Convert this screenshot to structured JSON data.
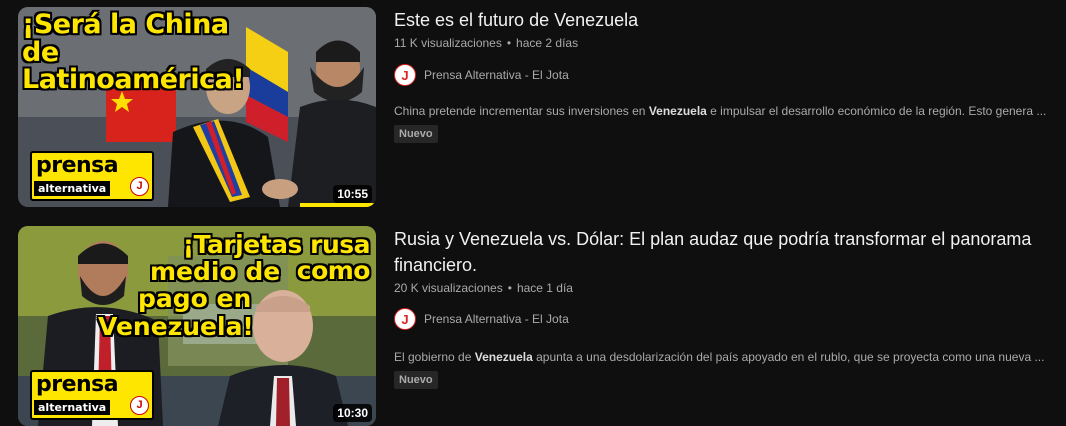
{
  "videos": [
    {
      "thumbnail_text": "¡Será la China de Latinoamérica!",
      "brand_main": "prensa",
      "brand_sub": "alternativa",
      "brand_logo": "J",
      "duration": "10:55",
      "title": "Este es el futuro de Venezuela",
      "views": "11 K visualizaciones",
      "age": "hace 2 días",
      "separator": "•",
      "channel": "Prensa Alternativa - El Jota",
      "avatar_letter": "J",
      "description_pre": "China pretende incrementar sus inversiones en ",
      "description_bold": "Venezuela",
      "description_post": " e impulsar el desarrollo económico de la región. Esto genera ...",
      "badge": "Nuevo"
    },
    {
      "thumbnail_text_1": "¡Tarjetas rusa como",
      "thumbnail_text_2": "medio de",
      "thumbnail_text_3": "pago en",
      "thumbnail_text_4": "Venezuela!",
      "brand_main": "prensa",
      "brand_sub": "alternativa",
      "brand_logo": "J",
      "duration": "10:30",
      "title": "Rusia y Venezuela vs. Dólar: El plan audaz que podría transformar el panorama financiero.",
      "views": "20 K visualizaciones",
      "age": "hace 1 día",
      "separator": "•",
      "channel": "Prensa Alternativa - El Jota",
      "avatar_letter": "J",
      "description_pre": "El gobierno de ",
      "description_bold": "Venezuela",
      "description_post": " apunta a una desdolarización del país apoyado en el rublo, que se proyecta como una nueva ...",
      "badge": "Nuevo"
    }
  ],
  "colors": {
    "background": "#0f0f0f",
    "thumbnail_text": "#ffe600",
    "secondary_text": "#aaaaaa"
  }
}
